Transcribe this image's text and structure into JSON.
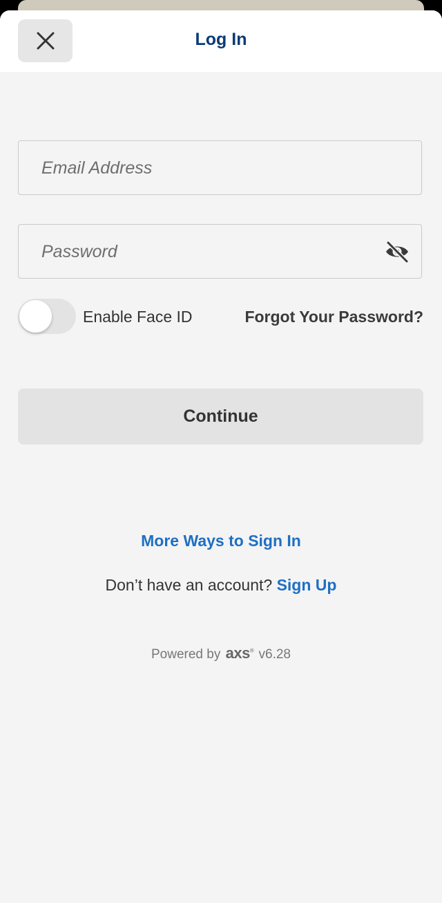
{
  "header": {
    "title": "Log In",
    "close_icon": "close-icon"
  },
  "form": {
    "email": {
      "placeholder": "Email Address",
      "value": ""
    },
    "password": {
      "placeholder": "Password",
      "value": "",
      "visibility_icon": "eye-slash-icon"
    },
    "face_id": {
      "label": "Enable Face ID",
      "enabled": false
    },
    "forgot_password": "Forgot Your Password?",
    "continue_label": "Continue"
  },
  "alternatives": {
    "more_ways": "More Ways to Sign In",
    "no_account_text": "Don’t have an account?",
    "sign_up": "Sign Up"
  },
  "footer": {
    "powered_by": "Powered by",
    "logo_text": "axs",
    "version": "v6.28"
  },
  "colors": {
    "title": "#0b3b73",
    "link": "#1e6fc3",
    "background": "#f4f4f4"
  }
}
